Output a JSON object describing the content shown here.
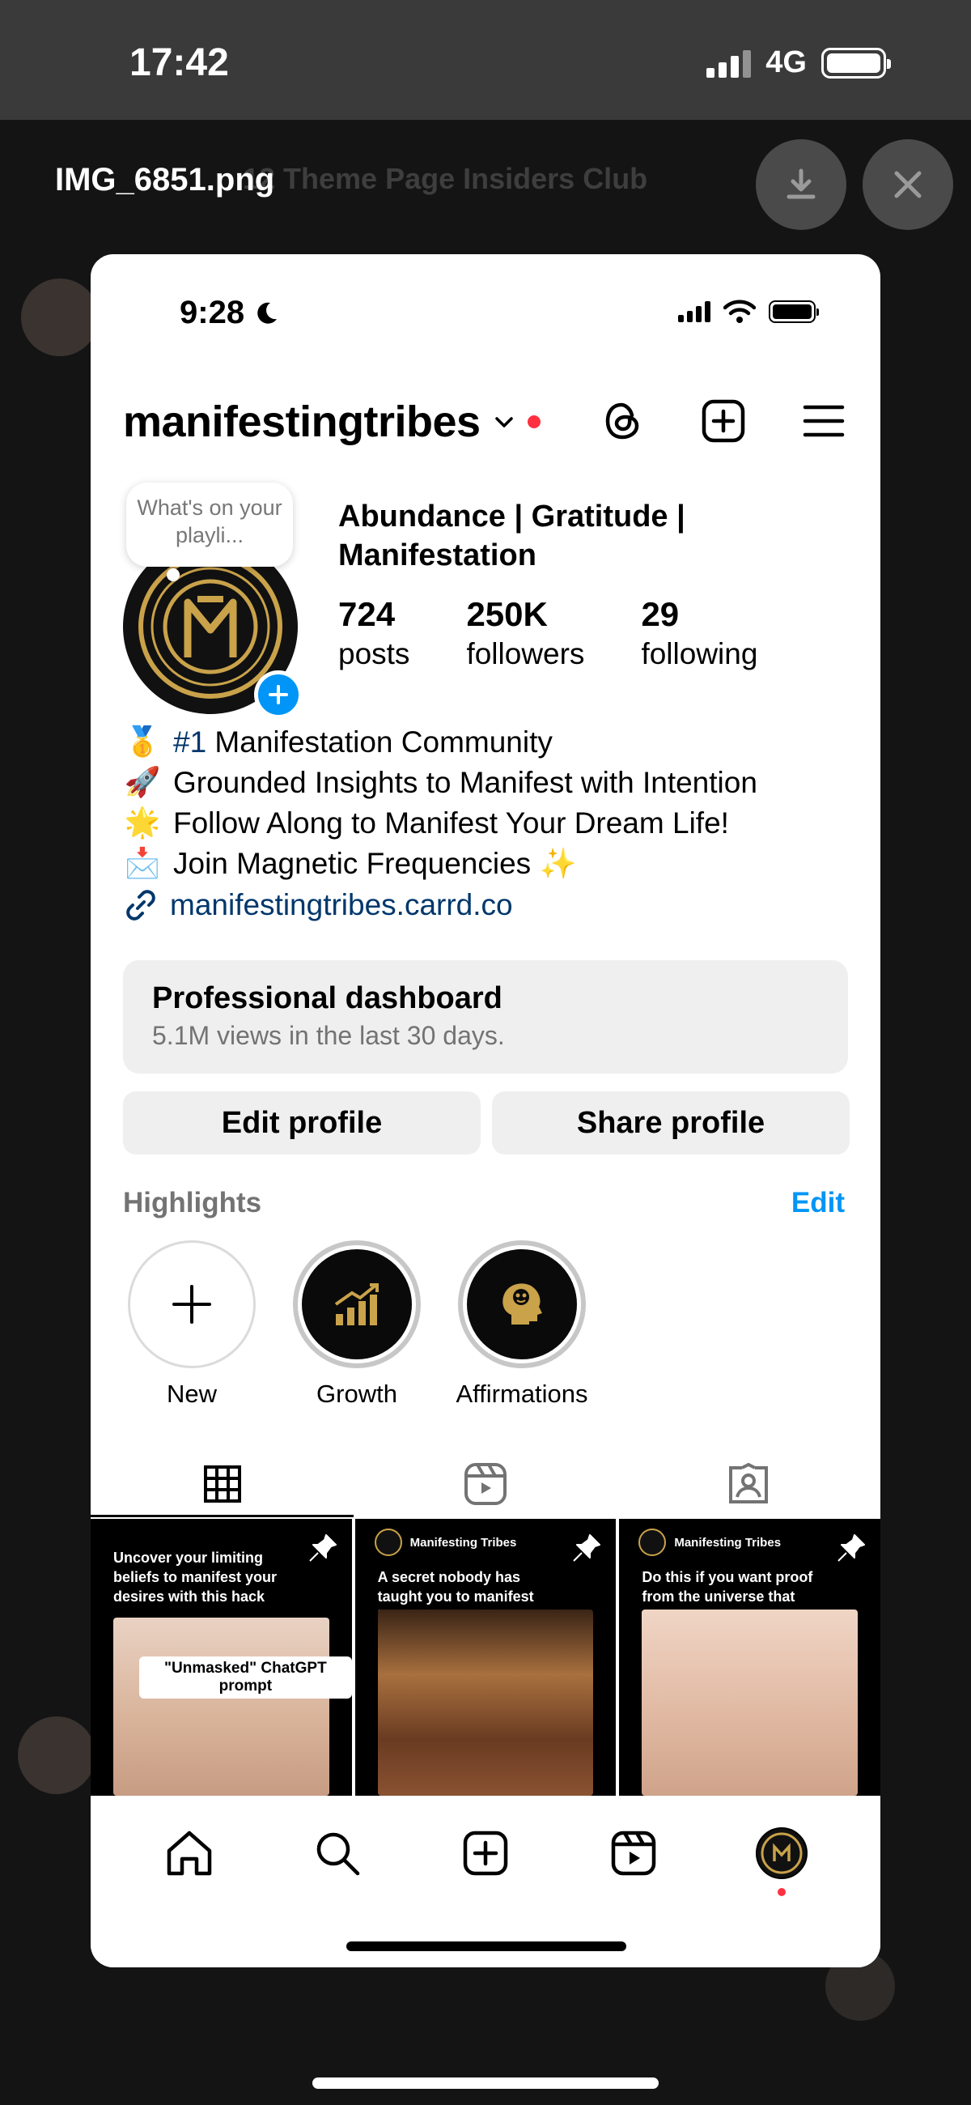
{
  "outer_status": {
    "time": "17:42",
    "network": "4G"
  },
  "viewer": {
    "filename": "IMG_6851.png",
    "background_title": "12 Theme Page Insiders Club"
  },
  "inner_status": {
    "time": "9:28"
  },
  "profile": {
    "username": "manifestingtribes",
    "note": "What's on your playli...",
    "name": "Abundance | Gratitude | Manifestation",
    "stats": [
      {
        "value": "724",
        "label": "posts"
      },
      {
        "value": "250K",
        "label": "followers"
      },
      {
        "value": "29",
        "label": "following"
      }
    ],
    "bio": [
      {
        "emoji": "🥇",
        "rank": "#1",
        "text": " Manifestation Community"
      },
      {
        "emoji": "🚀",
        "rank": "",
        "text": "Grounded Insights to Manifest with Intention"
      },
      {
        "emoji": "🌟",
        "rank": "",
        "text": "Follow Along to Manifest Your Dream Life!"
      },
      {
        "emoji": "📩",
        "rank": "",
        "text": "Join Magnetic Frequencies ✨"
      }
    ],
    "link": "manifestingtribes.carrd.co",
    "dashboard": {
      "title": "Professional dashboard",
      "subtitle": "5.1M views in the last 30 days."
    },
    "buttons": {
      "edit": "Edit profile",
      "share": "Share profile"
    },
    "highlights_label": "Highlights",
    "highlights_edit": "Edit",
    "highlights": [
      {
        "label": "New"
      },
      {
        "label": "Growth"
      },
      {
        "label": "Affirmations"
      }
    ]
  },
  "posts": [
    {
      "caption": "Uncover your limiting beliefs to manifest your desires with this hack",
      "overlay": "\"Unmasked\" ChatGPT prompt",
      "brand": ""
    },
    {
      "caption": "A secret nobody has taught you to manifest blessings in your life",
      "overlay": "",
      "brand": "Manifesting Tribes"
    },
    {
      "caption": "Do this if you want proof from the universe that Manifestation is real",
      "overlay": "",
      "brand": "Manifesting Tribes"
    }
  ],
  "colors": {
    "accent_blue": "#0095f6",
    "link_blue": "#00376b",
    "notif_red": "#ff3040",
    "gold": "#c9a24a"
  }
}
